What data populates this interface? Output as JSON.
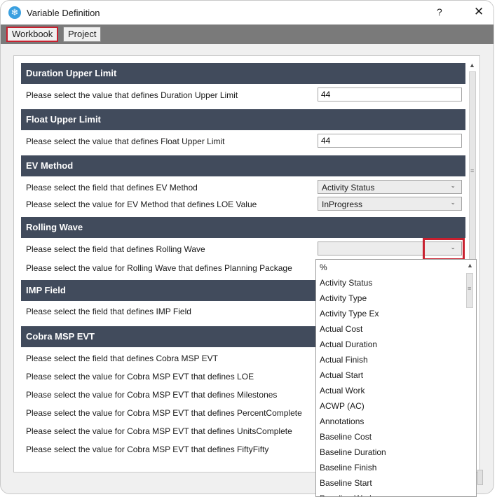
{
  "window": {
    "title": "Variable Definition",
    "help_label": "?",
    "close_label": "✕",
    "icon_name": "snowflake-icon"
  },
  "tabs": [
    {
      "label": "Workbook",
      "active": true
    },
    {
      "label": "Project",
      "active": false
    }
  ],
  "sections": {
    "duration_upper_limit": {
      "header": "Duration Upper Limit",
      "label": "Please select the value that defines Duration Upper Limit",
      "value": "44"
    },
    "float_upper_limit": {
      "header": "Float Upper Limit",
      "label": "Please select the value that defines Float Upper Limit",
      "value": "44"
    },
    "ev_method": {
      "header": "EV Method",
      "field_label": "Please select the field that defines EV Method",
      "field_value": "Activity Status",
      "loe_label": "Please select the value for EV Method that defines LOE Value",
      "loe_value": "InProgress"
    },
    "rolling_wave": {
      "header": "Rolling Wave",
      "field_label": "Please select the field that defines Rolling Wave",
      "field_value": "",
      "planning_label": "Please select the value for Rolling Wave that defines Planning Package"
    },
    "imp_field": {
      "header": "IMP Field",
      "label": "Please select the field that defines IMP Field"
    },
    "cobra_msp_evt": {
      "header": "Cobra MSP EVT",
      "rows": [
        "Please select the field that defines Cobra MSP EVT",
        "Please select the value for Cobra MSP EVT that defines LOE",
        "Please select the value for Cobra MSP EVT that defines Milestones",
        "Please select the value for Cobra MSP EVT that defines PercentComplete",
        "Please select the value for Cobra MSP EVT that defines UnitsComplete",
        "Please select the value for Cobra MSP EVT that defines FiftyFifty"
      ]
    }
  },
  "dropdown_options": [
    "%",
    "Activity Status",
    "Activity Type",
    "Activity Type Ex",
    "Actual Cost",
    "Actual Duration",
    "Actual Finish",
    "Actual Start",
    "Actual Work",
    "ACWP (AC)",
    "Annotations",
    "Baseline Cost",
    "Baseline Duration",
    "Baseline Finish",
    "Baseline Start",
    "Baseline Work"
  ],
  "colors": {
    "section_header_bg": "#414b5c",
    "highlight": "#c8202f",
    "tabbar_bg": "#7a7a7a"
  }
}
